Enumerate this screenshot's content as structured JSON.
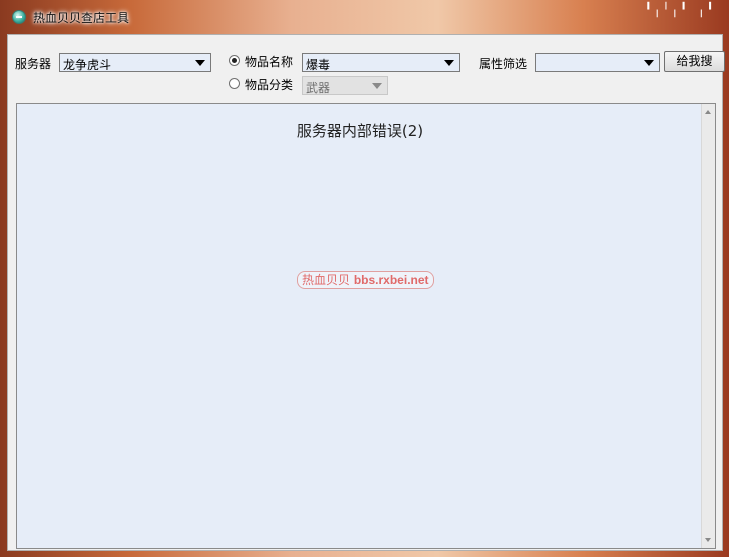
{
  "window": {
    "title": "热血贝贝查店工具",
    "caption_deco": "╹╷╵╷╹  ╷╹"
  },
  "form": {
    "server_label": "服务器",
    "server_value": "龙争虎斗",
    "item_name_label": "物品名称",
    "item_name_value": "爆毒",
    "item_category_label": "物品分类",
    "item_category_value": "武器",
    "attr_filter_label": "属性筛选",
    "attr_filter_value": "",
    "search_button": "给我搜",
    "search_mode": "item_name"
  },
  "results": {
    "message": "服务器内部错误(2)",
    "watermark_cn": "热血贝贝",
    "watermark_url": "bbs.rxbei.net"
  }
}
